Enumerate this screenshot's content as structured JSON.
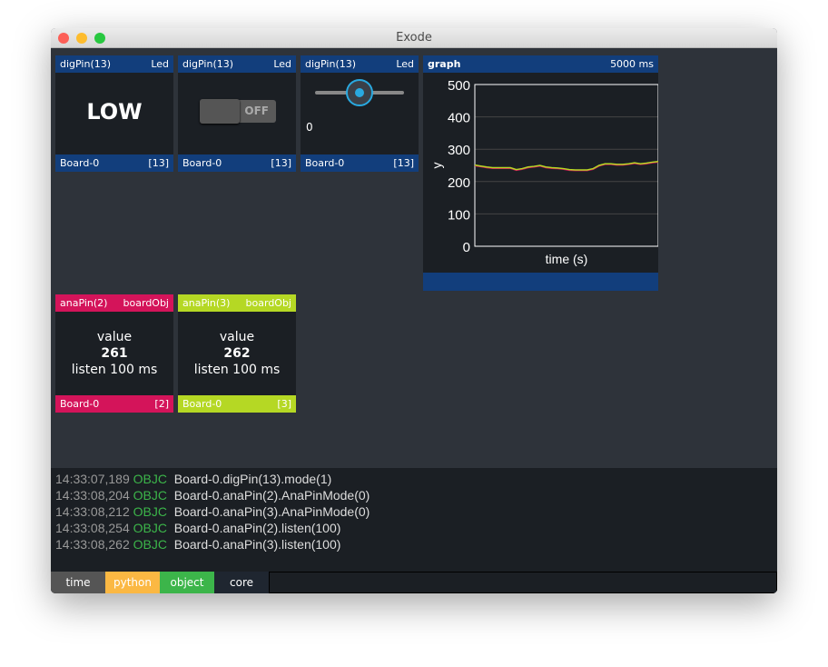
{
  "window": {
    "title": "Exode"
  },
  "digital_cards": [
    {
      "name": "digPin(13)",
      "type": "Led",
      "board": "Board-0",
      "pin": "[13]",
      "display": "LOW"
    },
    {
      "name": "digPin(13)",
      "type": "Led",
      "board": "Board-0",
      "pin": "[13]",
      "toggle_label": "OFF",
      "toggle_on": false
    },
    {
      "name": "digPin(13)",
      "type": "Led",
      "board": "Board-0",
      "pin": "[13]",
      "slider_value": "0",
      "slider_fraction": 0.5
    }
  ],
  "graph": {
    "title": "graph",
    "window": "5000 ms"
  },
  "chart_data": {
    "type": "line",
    "xlabel": "time (s)",
    "ylabel": "y",
    "ylim": [
      0,
      500
    ],
    "yticks": [
      "0",
      "100",
      "200",
      "300",
      "400",
      "500"
    ],
    "grid": true,
    "series": [
      {
        "color": "#d4145a",
        "values": [
          251,
          248,
          245,
          243,
          243,
          243,
          243,
          237,
          240,
          245,
          247,
          250,
          245,
          243,
          242,
          240,
          237,
          236,
          236,
          236,
          240,
          250,
          255,
          255,
          253,
          253,
          255,
          258,
          255,
          257,
          260,
          262
        ]
      },
      {
        "color": "#b5d824",
        "values": [
          251,
          248,
          245,
          243,
          243,
          243,
          243,
          237,
          240,
          245,
          247,
          250,
          245,
          243,
          242,
          240,
          237,
          236,
          236,
          236,
          240,
          250,
          255,
          255,
          253,
          253,
          255,
          258,
          255,
          257,
          260,
          262
        ]
      }
    ]
  },
  "analog_cards": [
    {
      "name": "anaPin(2)",
      "type": "boardObj",
      "label": "value",
      "value": "261",
      "listen": "listen 100 ms",
      "board": "Board-0",
      "pin": "[2]",
      "color": "#d4145a"
    },
    {
      "name": "anaPin(3)",
      "type": "boardObj",
      "label": "value",
      "value": "262",
      "listen": "listen 100 ms",
      "board": "Board-0",
      "pin": "[3]",
      "color": "#b5d824"
    }
  ],
  "log": [
    {
      "time": "14:33:07,189",
      "tag": "OBJC",
      "msg": "Board-0.digPin(13).mode(1)"
    },
    {
      "time": "14:33:08,204",
      "tag": "OBJC",
      "msg": "Board-0.anaPin(2).AnaPinMode(0)"
    },
    {
      "time": "14:33:08,212",
      "tag": "OBJC",
      "msg": "Board-0.anaPin(3).AnaPinMode(0)"
    },
    {
      "time": "14:33:08,254",
      "tag": "OBJC",
      "msg": "Board-0.anaPin(2).listen(100)"
    },
    {
      "time": "14:33:08,262",
      "tag": "OBJC",
      "msg": "Board-0.anaPin(3).listen(100)"
    }
  ],
  "tabs": [
    {
      "label": "time",
      "color": "#555555"
    },
    {
      "label": "python",
      "color": "#fbb843"
    },
    {
      "label": "object",
      "color": "#3cb54a"
    },
    {
      "label": "core",
      "color": "#1f2630"
    }
  ]
}
